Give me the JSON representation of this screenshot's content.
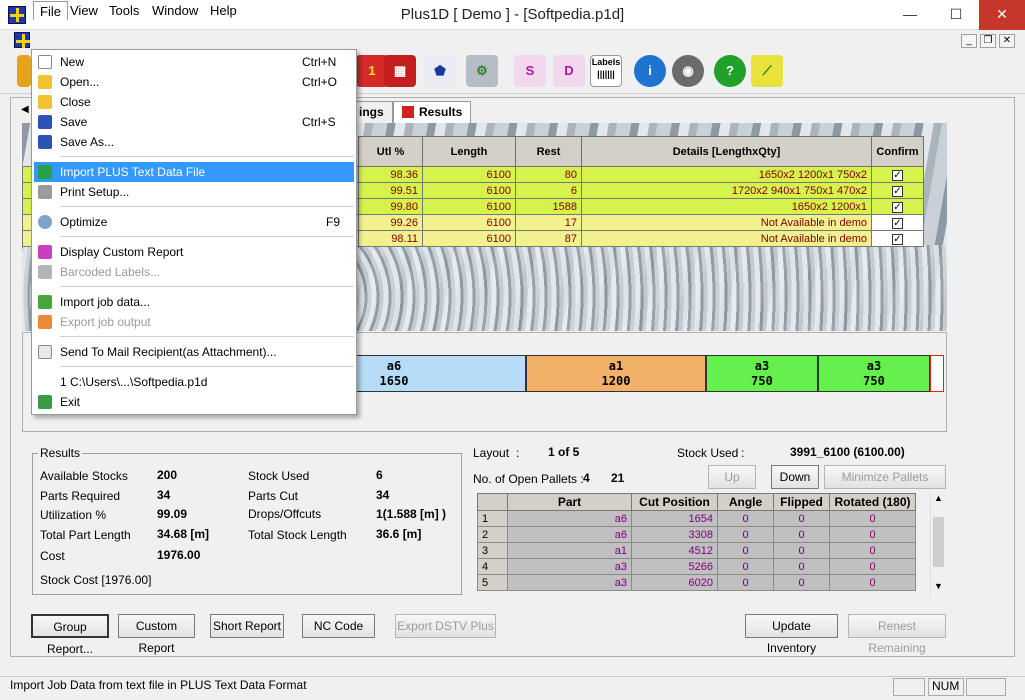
{
  "window": {
    "title": "Plus1D [ Demo ] - [Softpedia.p1d]",
    "min": "—",
    "max": "☐",
    "close": "✕"
  },
  "menubar": [
    "File",
    "View",
    "Tools",
    "Window",
    "Help"
  ],
  "toolbar": {
    "labels_icon_text": "Labels"
  },
  "tabs": {
    "settings": "ings",
    "results": "Results"
  },
  "results_table": {
    "headers": [
      "Utl %",
      "Length",
      "Rest",
      "Details [LengthxQty]",
      "Confirm"
    ],
    "rows": [
      {
        "id": "1",
        "utl": "98.36",
        "length": "6100",
        "rest": "80",
        "details": "1650x2   1200x1   750x2"
      },
      {
        "id": "2",
        "utl": "99.51",
        "length": "6100",
        "rest": "6",
        "details": "1720x2   940x1   750x1   470x2"
      },
      {
        "id": "1",
        "utl": "99.80",
        "length": "6100",
        "rest": "1588",
        "details": "1650x2   1200x1"
      },
      {
        "id": "1",
        "utl": "99.26",
        "length": "6100",
        "rest": "17",
        "details": "Not Available in demo"
      },
      {
        "id": "1",
        "utl": "98.11",
        "length": "6100",
        "rest": "87",
        "details": "Not Available in demo"
      }
    ]
  },
  "layout_bars": [
    {
      "name": "a6",
      "len": "1650"
    },
    {
      "name": "a1",
      "len": "1200"
    },
    {
      "name": "a3",
      "len": "750"
    },
    {
      "name": "a3",
      "len": "750"
    }
  ],
  "results_panel": {
    "title": "Results",
    "available_stocks_label": "Available Stocks",
    "available_stocks": "200",
    "parts_required_label": "Parts Required",
    "parts_required": "34",
    "utilization_label": "Utilization %",
    "utilization": "99.09",
    "total_part_length_label": "Total Part Length",
    "total_part_length": "34.68 [m]",
    "cost_label": "Cost",
    "cost": "1976.00",
    "stock_cost": "Stock Cost [1976.00]",
    "stock_used_label": "Stock Used",
    "stock_used": "6",
    "parts_cut_label": "Parts Cut",
    "parts_cut": "34",
    "drops_label": "Drops/Offcuts",
    "drops": "1(1.588 [m] )",
    "total_stock_length_label": "Total Stock Length",
    "total_stock_length": "36.6 [m]"
  },
  "layout_info": {
    "layout_label": "Layout",
    "layout_value": "1 of 5",
    "stock_used_label": "Stock Used",
    "stock_used_value": "3991_6100 (6100.00)",
    "open_pallets_label": "No. of Open Pallets :",
    "open_pallets_a": "4",
    "open_pallets_b": "21",
    "up": "Up",
    "down": "Down",
    "minimize": "Minimize Pallets"
  },
  "parts_table": {
    "headers": [
      "Part",
      "Cut Position",
      "Angle",
      "Flipped",
      "Rotated (180)"
    ],
    "rows": [
      [
        "1",
        "a6",
        "1654",
        "0",
        "0",
        "0"
      ],
      [
        "2",
        "a6",
        "3308",
        "0",
        "0",
        "0"
      ],
      [
        "3",
        "a1",
        "4512",
        "0",
        "0",
        "0"
      ],
      [
        "4",
        "a3",
        "5266",
        "0",
        "0",
        "0"
      ],
      [
        "5",
        "a3",
        "6020",
        "0",
        "0",
        "0"
      ]
    ]
  },
  "bottom_buttons": [
    "Group Report...",
    "Custom Report",
    "Short Report",
    "NC Code",
    "Export DSTV Plus",
    "Update Inventory",
    "Renest Remaining"
  ],
  "status": {
    "text": "Import Job Data from text file in PLUS Text Data Format",
    "num": "NUM"
  },
  "file_menu": {
    "new": "New",
    "new_sc": "Ctrl+N",
    "open": "Open...",
    "open_sc": "Ctrl+O",
    "close": "Close",
    "save": "Save",
    "save_sc": "Ctrl+S",
    "saveas": "Save As...",
    "import_plus": "Import PLUS Text Data File",
    "print_setup": "Print Setup...",
    "optimize": "Optimize",
    "optimize_sc": "F9",
    "custom_report": "Display Custom Report",
    "barcoded": "Barcoded Labels...",
    "import_job": "Import job data...",
    "export_job": "Export job output",
    "send_mail": "Send To Mail Recipient(as Attachment)...",
    "recent": "1 C:\\Users\\...\\Softpedia.p1d",
    "exit": "Exit"
  }
}
